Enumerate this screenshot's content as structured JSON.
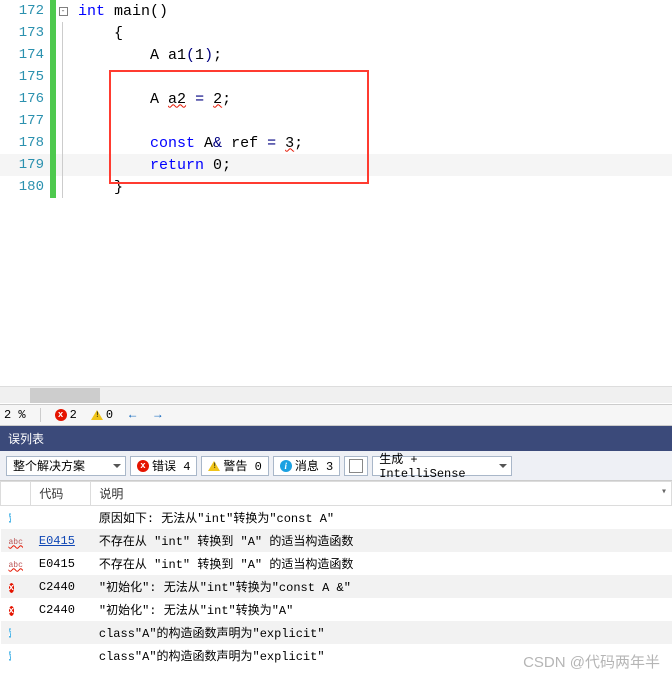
{
  "code": {
    "lines": [
      {
        "n": "172",
        "segs": [
          {
            "t": "int",
            "c": "kw"
          },
          {
            "t": " main()",
            "c": ""
          }
        ],
        "fold": true
      },
      {
        "n": "173",
        "segs": [
          {
            "t": "{",
            "c": ""
          }
        ],
        "indent": 1
      },
      {
        "n": "174",
        "segs": [
          {
            "t": "A a1",
            "c": ""
          },
          {
            "t": "(",
            "c": "op"
          },
          {
            "t": "1",
            "c": "num"
          },
          {
            "t": ")",
            "c": "op"
          },
          {
            "t": ";",
            "c": ""
          }
        ],
        "indent": 2
      },
      {
        "n": "175",
        "segs": [],
        "indent": 2
      },
      {
        "n": "176",
        "segs": [
          {
            "t": "A ",
            "c": ""
          },
          {
            "t": "a2",
            "c": "squiggle"
          },
          {
            "t": " ",
            "c": ""
          },
          {
            "t": "=",
            "c": "op"
          },
          {
            "t": " ",
            "c": ""
          },
          {
            "t": "2",
            "c": "num squiggle"
          },
          {
            "t": ";",
            "c": ""
          }
        ],
        "indent": 2
      },
      {
        "n": "177",
        "segs": [],
        "indent": 2
      },
      {
        "n": "178",
        "segs": [
          {
            "t": "const",
            "c": "kw"
          },
          {
            "t": " A",
            "c": ""
          },
          {
            "t": "&",
            "c": "op"
          },
          {
            "t": " ref ",
            "c": ""
          },
          {
            "t": "=",
            "c": "op"
          },
          {
            "t": " ",
            "c": ""
          },
          {
            "t": "3",
            "c": "num squiggle"
          },
          {
            "t": ";",
            "c": ""
          }
        ],
        "indent": 2
      },
      {
        "n": "179",
        "segs": [
          {
            "t": "return",
            "c": "kw"
          },
          {
            "t": " ",
            "c": ""
          },
          {
            "t": "0",
            "c": "num"
          },
          {
            "t": ";",
            "c": ""
          }
        ],
        "indent": 2,
        "current": true
      },
      {
        "n": "180",
        "segs": [
          {
            "t": "}",
            "c": ""
          }
        ],
        "indent": 1
      }
    ]
  },
  "status": {
    "zoom": "2 %",
    "errors": "2",
    "warnings": "0"
  },
  "errlist": {
    "title": "误列表",
    "scope": "整个解决方案",
    "tabs": {
      "errors": "错误 4",
      "warnings": "警告 0",
      "messages": "消息 3"
    },
    "source": "生成 + IntelliSense",
    "cols": {
      "code": "代码",
      "desc": "说明"
    },
    "rows": [
      {
        "icon": "info",
        "code": "",
        "desc": "原因如下: 无法从\"int\"转换为\"const A\"",
        "alt": false
      },
      {
        "icon": "abc",
        "code": "E0415",
        "link": true,
        "desc": "不存在从 \"int\" 转换到 \"A\" 的适当构造函数",
        "alt": true
      },
      {
        "icon": "abc",
        "code": "E0415",
        "desc": "不存在从 \"int\" 转换到 \"A\" 的适当构造函数",
        "alt": false
      },
      {
        "icon": "error",
        "code": "C2440",
        "desc": "\"初始化\": 无法从\"int\"转换为\"const A &\"",
        "alt": true
      },
      {
        "icon": "error",
        "code": "C2440",
        "desc": "\"初始化\": 无法从\"int\"转换为\"A\"",
        "alt": false
      },
      {
        "icon": "info",
        "code": "",
        "desc": "class\"A\"的构造函数声明为\"explicit\"",
        "alt": true
      },
      {
        "icon": "info",
        "code": "",
        "desc": "class\"A\"的构造函数声明为\"explicit\"",
        "alt": false
      }
    ]
  },
  "watermark": "CSDN @代码两年半"
}
